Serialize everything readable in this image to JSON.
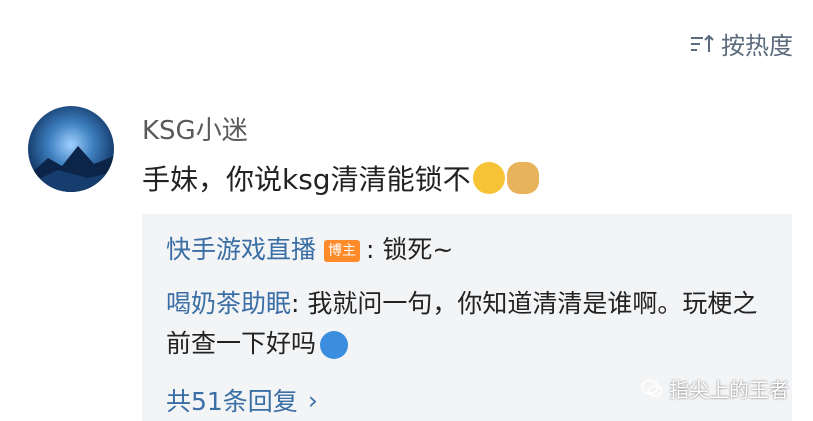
{
  "sort": {
    "label": "按热度",
    "icon": "sort-icon"
  },
  "comment": {
    "avatar": "avatar",
    "username": "KSG小迷",
    "text": "手妹，你说ksg清清能锁不"
  },
  "replies": {
    "items": [
      {
        "user": "快手游戏直播",
        "badge": "博主",
        "text": ": 锁死~"
      },
      {
        "user": "喝奶茶助眠",
        "text": ": 我就问一句，你知道清清是谁啊。玩梗之前查一下好吗"
      }
    ],
    "more_label": "共51条回复"
  },
  "watermark": {
    "text": "指尖上的王者"
  }
}
